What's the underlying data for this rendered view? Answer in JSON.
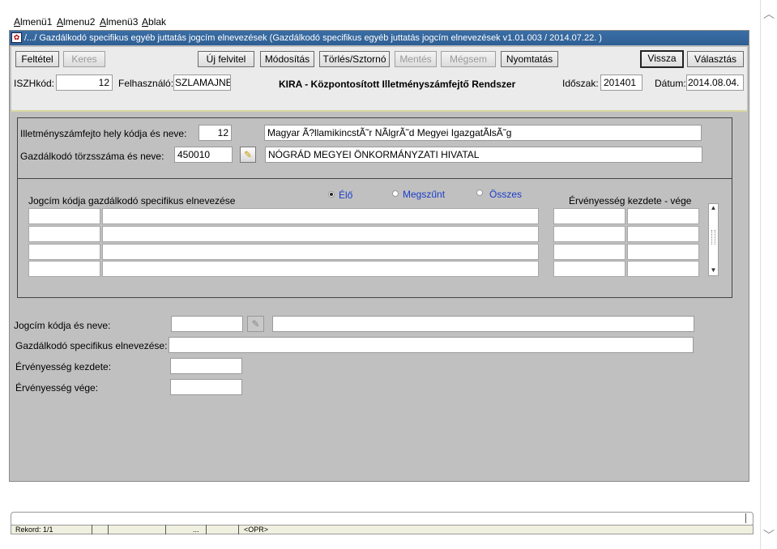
{
  "menu": {
    "items": [
      {
        "first": "A",
        "rest": "lmenü1"
      },
      {
        "first": "A",
        "rest": "lmenu2"
      },
      {
        "first": "A",
        "rest": "lmenü3"
      },
      {
        "first": "A",
        "rest": "blak"
      }
    ]
  },
  "window": {
    "title": "/.../ Gazdálkodó specifikus egyéb juttatás jogcím elnevezések (Gazdálkodó specifikus egyéb juttatás jogcím elnevezések v1.01.003 / 2014.07.22. )"
  },
  "toolbar": {
    "feltetel": "Feltétel",
    "keres": "Keres",
    "uj_felvitel": "Új felvitel",
    "modositas": "Módosítás",
    "torles": "Törlés/Sztornó",
    "mentes": "Mentés",
    "megsem": "Mégsem",
    "nyomtatas": "Nyomtatás",
    "vissza": "Vissza",
    "valasztas": "Választás"
  },
  "header": {
    "iszh_label": "ISZHkód:",
    "iszh_value": "12",
    "user_label": "Felhasználó:",
    "user_value": "SZLAMAJNE",
    "system_title": "KIRA - Központosított Illetményszámfejtő Rendszer",
    "period_label": "Időszak:",
    "period_value": "201401",
    "date_label": "Dátum:",
    "date_value": "2014.08.04."
  },
  "org": {
    "payroll_label": "Illetményszámfejto hely kódja és neve:",
    "payroll_code": "12",
    "payroll_name": "Magyar Ã?llamikincstÃ˜r NÃlgrÃ˜d Megyei IgazgatÃlsÃ˜g",
    "manager_label": "Gazdálkodó törzsszáma és neve:",
    "manager_code": "450010",
    "manager_name": "NÓGRÁD MEGYEI ÖNKORMÁNYZATI  HIVATAL"
  },
  "list": {
    "col_header": "Jogcím kódja gazdálkodó specifikus elnevezése",
    "validity_header": "Érvényesség  kezdete -  vége",
    "radio_elo": "Élő",
    "radio_megszunt": "Megszűnt",
    "radio_osszes": "Összes"
  },
  "detail": {
    "jogcim_label": "Jogcím kódja és neve:",
    "gazd_label": "Gazdálkodó specifikus elnevezése:",
    "kezdete_label": "Érvényesség kezdete:",
    "vege_label": "Érvényesség vége:"
  },
  "status": {
    "record": "Rekord: 1/1",
    "dots": "...",
    "mode": "<OPR>"
  }
}
